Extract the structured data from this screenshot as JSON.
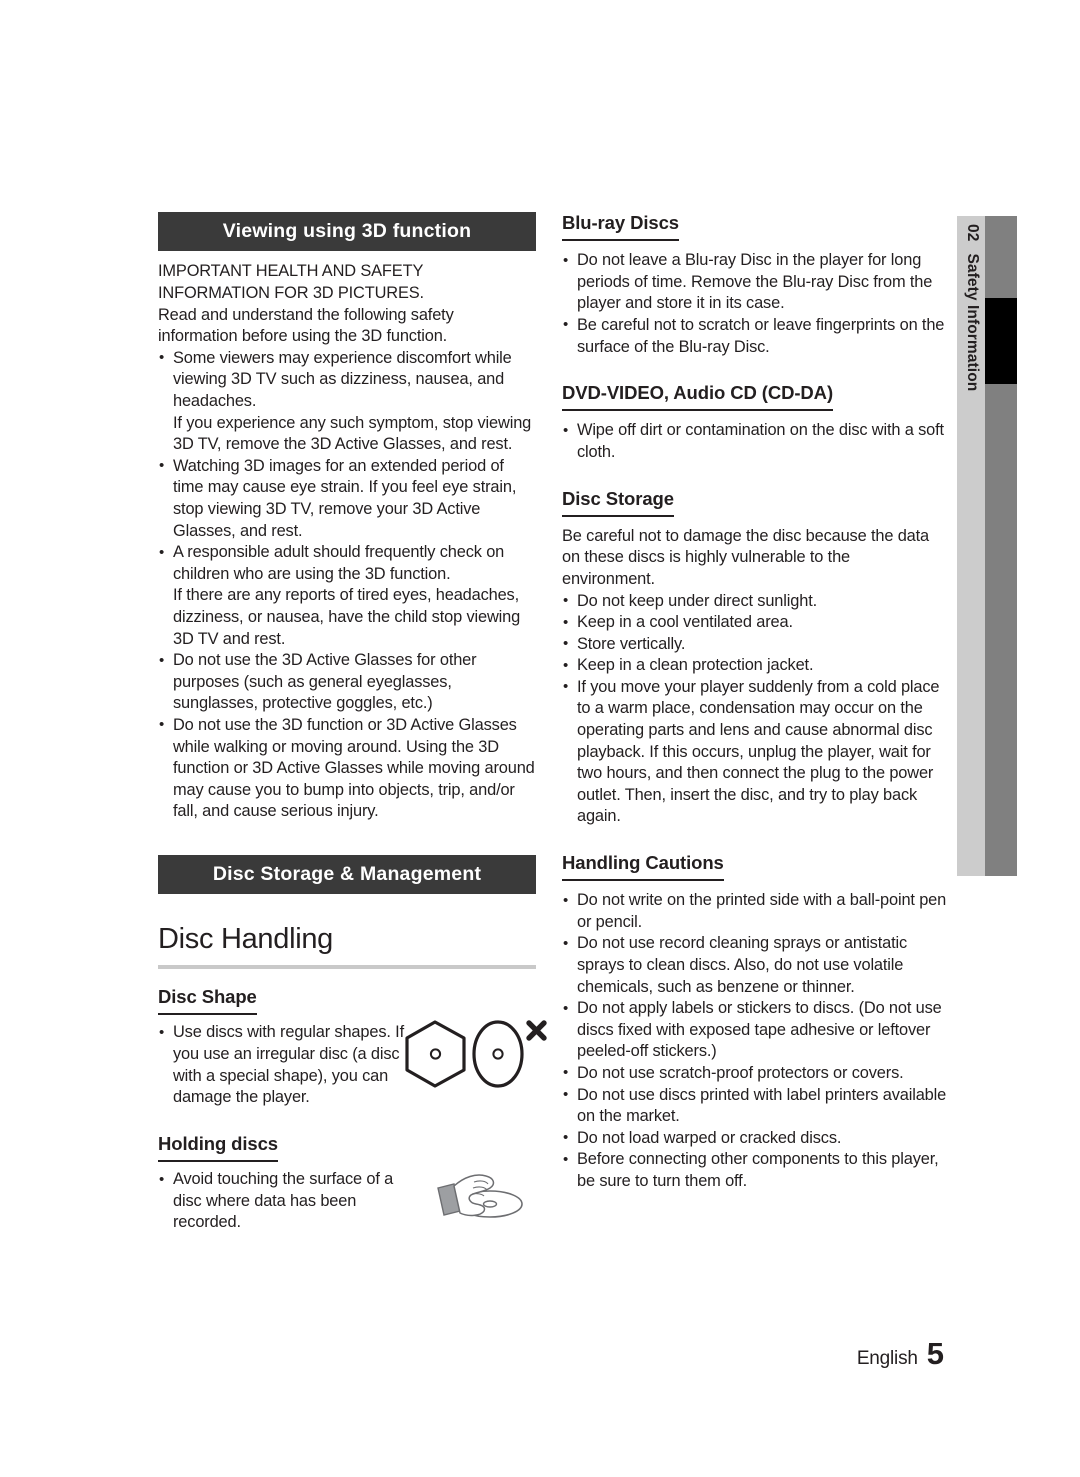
{
  "document": {
    "side_tab": {
      "number": "02",
      "label": "Safety Information"
    },
    "footer": {
      "language": "English",
      "page_number": "5"
    }
  },
  "left_column": {
    "section_title": "Viewing using 3D function",
    "intro": {
      "line1": "IMPORTANT HEALTH AND SAFETY",
      "line2": "INFORMATION FOR 3D PICTURES.",
      "line3": "Read and understand the following safety",
      "line4": "information before using the 3D function."
    },
    "bullets": [
      "Some viewers may experience discomfort while viewing 3D TV such as dizziness, nausea, and headaches.",
      "Watching 3D images for an extended period of time may cause eye strain. If you feel eye strain, stop viewing 3D TV, remove your 3D Active Glasses, and rest.",
      "A responsible adult should frequently check on children who are using the 3D function.",
      "Do not use the 3D Active Glasses for other purposes (such as general eyeglasses, sunglasses, protective goggles, etc.)",
      "Do not use the 3D function or 3D Active Glasses while walking or moving around. Using the 3D function or 3D Active Glasses while moving around may cause you to bump into objects, trip, and/or fall, and cause serious injury."
    ],
    "sub_paragraphs": {
      "after_bullet_1": "If you experience any such symptom, stop viewing 3D TV, remove the 3D Active Glasses, and rest.",
      "after_bullet_3": "If there are any reports of tired eyes, headaches, dizziness, or nausea, have the child stop viewing 3D TV and rest."
    },
    "section_title_2": "Disc Storage & Management",
    "big_heading": "Disc Handling",
    "disc_shape": {
      "heading": "Disc Shape",
      "bullet": "Use discs with regular shapes. If you use an irregular disc (a disc with a special shape), you can damage the player."
    },
    "holding_discs": {
      "heading": "Holding discs",
      "bullet": "Avoid touching the surface of a disc where data has been recorded."
    }
  },
  "right_column": {
    "blu_ray": {
      "heading": "Blu-ray Discs",
      "bullets": [
        "Do not leave a Blu-ray Disc in the player for long periods of time. Remove the Blu-ray Disc from the player and store it in its case.",
        "Be careful not to scratch or leave fingerprints on the surface of the Blu-ray Disc."
      ]
    },
    "dvd_video": {
      "heading": "DVD-VIDEO, Audio CD (CD-DA)",
      "bullets": [
        "Wipe off dirt or contamination on the disc with a soft cloth."
      ]
    },
    "disc_storage": {
      "heading": "Disc Storage",
      "intro": "Be careful not to damage the disc because the data on these discs is highly vulnerable to the environment.",
      "bullets": [
        "Do not keep under direct sunlight.",
        "Keep in a cool ventilated area.",
        "Store vertically.",
        "Keep in a clean protection jacket.",
        "If you move your player suddenly from a cold place to a warm place, condensation may occur on the operating parts and lens and cause abnormal disc playback. If this occurs, unplug the player, wait for two hours, and then connect the plug to the power outlet. Then, insert the disc, and try to play back again."
      ]
    },
    "handling_cautions": {
      "heading": "Handling Cautions",
      "bullets": [
        "Do not write on the printed side with a ball-point pen or pencil.",
        "Do not use record cleaning sprays or antistatic sprays to clean discs. Also, do not use volatile chemicals, such as benzene or thinner.",
        "Do not apply labels or stickers to discs. (Do not use discs fixed with exposed tape adhesive or leftover peeled-off stickers.)",
        "Do not use scratch-proof protectors or covers.",
        "Do not use discs printed with label printers available on the market.",
        "Do not load warped or cracked discs.",
        "Before connecting other components to this player, be sure to turn them off."
      ]
    }
  },
  "colors": {
    "banner_bg": "#3a3a3a",
    "banner_text": "#ffffff",
    "body_text": "#231f20",
    "rule_gray": "#c9c9c9",
    "tab_light": "#cccccc",
    "tab_dark": "#808080",
    "tab_marker": "#000000"
  }
}
